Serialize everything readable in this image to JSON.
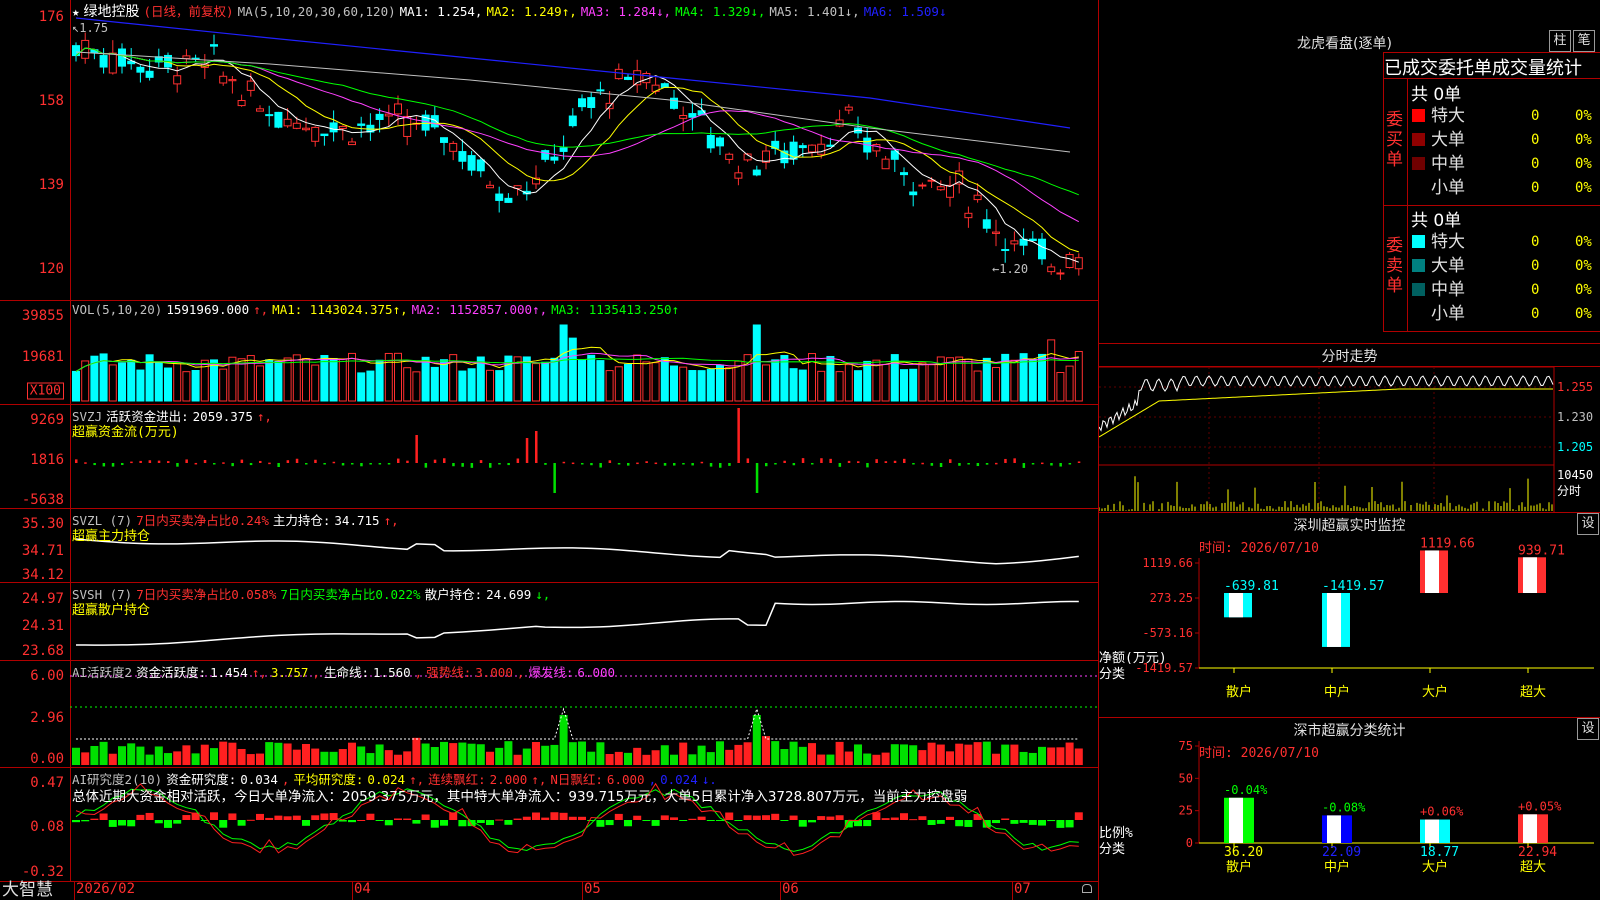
{
  "stock": {
    "name": "绿地控股",
    "mode": "(日线，前复权)",
    "high_mark": "1.75",
    "low_mark": "1.20"
  },
  "price_pane": {
    "ma_label": "MA(5,10,20,30,60,120)",
    "ma": [
      {
        "label": "MA1:",
        "value": "1.254",
        "color": "#ffffff",
        "arrow": ""
      },
      {
        "label": "MA2:",
        "value": "1.249",
        "color": "#ffff00",
        "arrow": "↑"
      },
      {
        "label": "MA3:",
        "value": "1.284",
        "color": "#ff40ff",
        "arrow": "↓"
      },
      {
        "label": "MA4:",
        "value": "1.329",
        "color": "#00ff00",
        "arrow": "↓"
      },
      {
        "label": "MA5:",
        "value": "1.401",
        "color": "#c0c0c0",
        "arrow": "↓"
      },
      {
        "label": "MA6:",
        "value": "1.509",
        "color": "#2020ff",
        "arrow": "↓"
      }
    ],
    "yticks": [
      "176",
      "158",
      "139",
      "120"
    ]
  },
  "vol_pane": {
    "label": "VOL(5,10,20)",
    "value": "1591969.000",
    "ma": [
      {
        "label": "MA1:",
        "value": "1143024.375",
        "color": "#ffff00"
      },
      {
        "label": "MA2:",
        "value": "1152857.000",
        "color": "#ff40ff"
      },
      {
        "label": "MA3:",
        "value": "1135413.250",
        "color": "#00ff00"
      }
    ],
    "yticks": [
      "39855",
      "19681"
    ],
    "unit": "X100"
  },
  "svzj_pane": {
    "label": "SVZJ",
    "text": "活跃资金进出:",
    "value": "2059.375",
    "subtitle": "超赢资金流(万元)",
    "yticks": [
      "9269",
      "1816",
      "-5638"
    ]
  },
  "svzl_pane": {
    "label": "SVZL (7)",
    "text1": "7日内买卖净占比0.24%",
    "text2": "主力持仓:",
    "value": "34.715",
    "subtitle": "超赢主力持仓",
    "yticks": [
      "35.30",
      "34.71",
      "34.12"
    ]
  },
  "svsh_pane": {
    "label": "SVSH (7)",
    "text1": "7日内买卖净占比0.058%",
    "text2": "7日内买卖净占比0.022%",
    "text3": "散户持仓:",
    "value": "24.699",
    "subtitle": "超赢散户持仓",
    "yticks": [
      "24.97",
      "24.31",
      "23.68"
    ]
  },
  "ai_pane": {
    "label": "AI活跃度2",
    "t1": "资金活跃度:",
    "v1": "1.454",
    "v2": "3.757",
    "t3": "生命线:",
    "v3": "1.560",
    "t4": "强势线:",
    "v4": "3.000",
    "t5": "爆发线:",
    "v5": "6.000",
    "yticks": [
      "6.00",
      "2.96",
      "0.00"
    ]
  },
  "research_pane": {
    "label": "AI研究度2(10)",
    "t1": "资金研究度:",
    "v1": "0.034",
    "t2": "平均研究度:",
    "v2": "0.024",
    "t3": "连续飘红:",
    "v3": "2.000",
    "t4": "N日飘红:",
    "v4": "6.000",
    "v5": "0.024",
    "summary": "总体近期大资金相对活跃，今日大单净流入：2059.375万元，其中特大单净流入：939.715万元，大单5日累计净入3728.807万元，当前主力控盘弱",
    "yticks": [
      "0.47",
      "0.08",
      "-0.32"
    ]
  },
  "xaxis": {
    "labels": [
      "2026/02",
      "04",
      "05",
      "06",
      "07"
    ]
  },
  "brand": "大智慧",
  "dragon": {
    "title": "龙虎看盘(逐单)",
    "btn1": "柱",
    "btn2": "笔",
    "header": "已成交委托单成交量统计",
    "buy_label": "委买单",
    "sell_label": "委卖单",
    "buy_total": "共 0单",
    "sell_total": "共 0单",
    "buy_rows": [
      {
        "name": "特大",
        "count": "0",
        "pct": "0%",
        "color": "#ff0000"
      },
      {
        "name": "大单",
        "count": "0",
        "pct": "0%",
        "color": "#900000"
      },
      {
        "name": "中单",
        "count": "0",
        "pct": "0%",
        "color": "#700000"
      },
      {
        "name": "小单",
        "count": "0",
        "pct": "0%",
        "color": ""
      }
    ],
    "sell_rows": [
      {
        "name": "特大",
        "count": "0",
        "pct": "0%",
        "color": "#00ffff"
      },
      {
        "name": "大单",
        "count": "0",
        "pct": "0%",
        "color": "#008080"
      },
      {
        "name": "中单",
        "count": "0",
        "pct": "0%",
        "color": "#006060"
      },
      {
        "name": "小单",
        "count": "0",
        "pct": "0%",
        "color": ""
      }
    ]
  },
  "intraday": {
    "title": "分时走势",
    "yticks": [
      "1.255",
      "1.230",
      "1.205"
    ],
    "vol_label": "10450",
    "vol_unit": "分时"
  },
  "monitor": {
    "title": "深圳超赢实时监控",
    "btn": "设",
    "time": "时间: 2026/07/10",
    "yticks": [
      "1119.66",
      "273.25",
      "-573.16",
      "-1419.57"
    ],
    "ylabel": "净额(万元)",
    "xlabel": "分类",
    "bars": [
      {
        "cat": "散户",
        "value": -639.81,
        "label": "-639.81"
      },
      {
        "cat": "中户",
        "value": -1419.57,
        "label": "-1419.57"
      },
      {
        "cat": "大户",
        "value": 1119.66,
        "label": "1119.66"
      },
      {
        "cat": "超大",
        "value": 939.71,
        "label": "939.71"
      }
    ]
  },
  "classify": {
    "title": "深市超赢分类统计",
    "btn": "设",
    "time": "时间: 2026/07/10",
    "yticks": [
      "75",
      "50",
      "25",
      "0"
    ],
    "ylabel": "比例%",
    "xlabel": "分类",
    "bars": [
      {
        "cat": "散户",
        "value": 36.2,
        "label": "36.20",
        "delta": "-0.04%"
      },
      {
        "cat": "中户",
        "value": 22.09,
        "label": "22.09",
        "delta": "-0.08%"
      },
      {
        "cat": "大户",
        "value": 18.77,
        "label": "18.77",
        "delta": "+0.06%"
      },
      {
        "cat": "超大",
        "value": 22.94,
        "label": "22.94",
        "delta": "+0.05%"
      }
    ]
  }
}
